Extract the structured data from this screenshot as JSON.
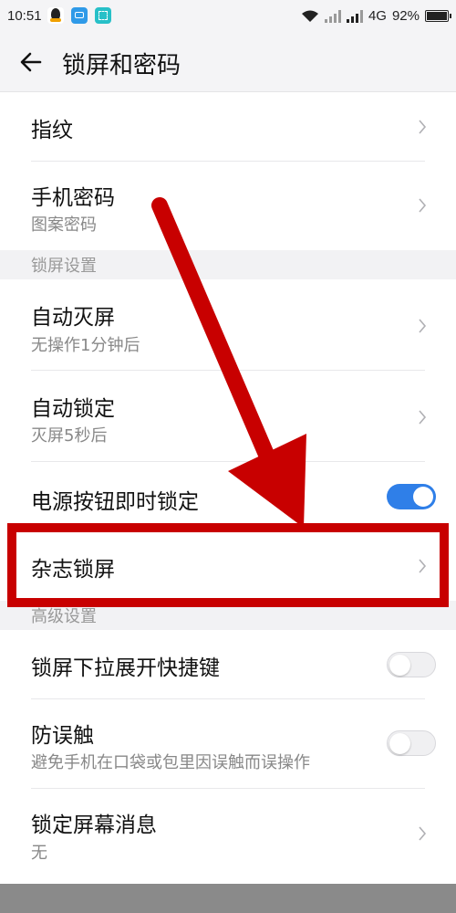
{
  "statusbar": {
    "time": "10:51",
    "network": "4G",
    "battery": "92%"
  },
  "header": {
    "title": "锁屏和密码"
  },
  "items": [
    {
      "title": "指纹"
    },
    {
      "title": "手机密码",
      "subtitle": "图案密码"
    }
  ],
  "sections": {
    "lockscreen": "锁屏设置",
    "advanced": "高级设置"
  },
  "lockscreen_items": [
    {
      "title": "自动灭屏",
      "subtitle": "无操作1分钟后"
    },
    {
      "title": "自动锁定",
      "subtitle": "灭屏5秒后"
    },
    {
      "title": "电源按钮即时锁定",
      "toggle": true
    },
    {
      "title": "杂志锁屏"
    }
  ],
  "advanced_items": [
    {
      "title": "锁屏下拉展开快捷键",
      "toggle": false
    },
    {
      "title": "防误触",
      "subtitle": "避免手机在口袋或包里因误触而误操作",
      "toggle": false
    },
    {
      "title": "锁定屏幕消息",
      "subtitle": "无"
    }
  ],
  "colors": {
    "accent": "#2f7fe8",
    "annotation": "#c80000"
  }
}
